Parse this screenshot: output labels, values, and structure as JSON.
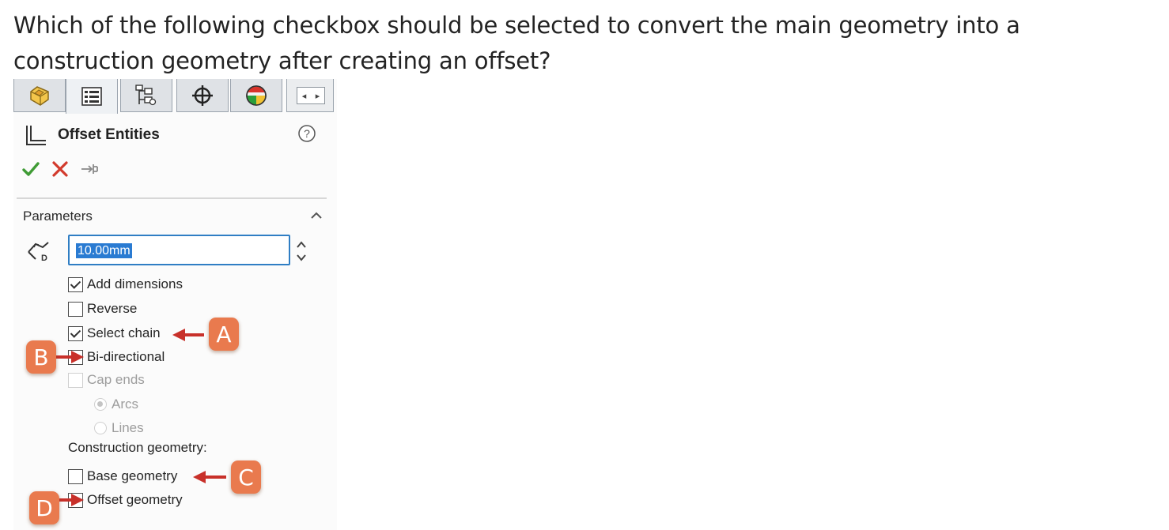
{
  "question": "Which of the following checkbox should be selected to convert the main geometry into a construction geometry after creating an offset?",
  "panel": {
    "tabs": [
      {
        "icon": "feature-manager-icon",
        "active": false
      },
      {
        "icon": "property-manager-icon",
        "active": true
      },
      {
        "icon": "configuration-manager-icon",
        "active": false
      },
      {
        "icon": "dimxpert-manager-icon",
        "active": false
      },
      {
        "icon": "display-manager-icon",
        "active": false
      }
    ],
    "title": "Offset Entities",
    "actions": {
      "ok": "ok-check-icon",
      "cancel": "cancel-x-icon",
      "pin": "pin-icon"
    },
    "section": "Parameters",
    "distance": "10.00mm",
    "options": {
      "add_dimensions": {
        "label": "Add dimensions",
        "checked": true
      },
      "reverse": {
        "label": "Reverse",
        "checked": false
      },
      "select_chain": {
        "label": "Select chain",
        "checked": true
      },
      "bi_directional": {
        "label": "Bi-directional",
        "checked": false
      },
      "cap_ends": {
        "label": "Cap ends",
        "checked": false,
        "disabled": true
      },
      "arcs": {
        "label": "Arcs",
        "selected": true,
        "disabled": true
      },
      "lines": {
        "label": "Lines",
        "selected": false,
        "disabled": true
      },
      "construction_label": "Construction geometry:",
      "base_geometry": {
        "label": "Base geometry",
        "checked": false
      },
      "offset_geometry": {
        "label": "Offset geometry",
        "checked": false
      }
    }
  },
  "callouts": {
    "a": "A",
    "b": "B",
    "c": "C",
    "d": "D"
  },
  "colors": {
    "callout": "#e97a4e",
    "arrow": "#c8302a",
    "ok": "#3f9b35",
    "cancel": "#d23a2c",
    "selection": "#2a7bd2"
  }
}
